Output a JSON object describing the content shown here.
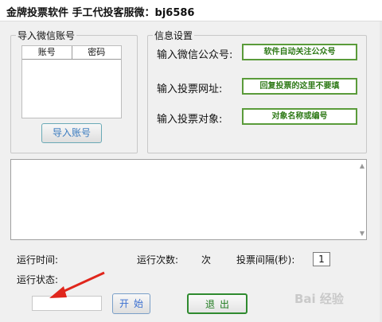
{
  "window": {
    "title": "金牌投票软件  手工代投客服微：bj6586"
  },
  "import_group": {
    "legend": "导入微信账号",
    "columns": [
      "账号",
      "密码"
    ],
    "import_button": "导入账号"
  },
  "info_group": {
    "legend": "信息设置",
    "fields": [
      {
        "label": "输入微信公众号:",
        "value": "软件自动关注公众号"
      },
      {
        "label": "输入投票网址:",
        "value": "回复投票的这里不要填"
      },
      {
        "label": "输入投票对象:",
        "value": "对象名称或编号"
      }
    ]
  },
  "status": {
    "run_time_label": "运行时间:",
    "run_count_label": "运行次数:",
    "run_count_unit": "次",
    "interval_label": "投票间隔(秒):",
    "interval_value": "1",
    "run_state_label": "运行状态:"
  },
  "buttons": {
    "start": "开始",
    "stop": "退出"
  },
  "watermark": "Bai 经验",
  "colors": {
    "accent_green": "#2f8a2f",
    "accent_blue": "#3a7bbf",
    "arrow_red": "#e0261c"
  }
}
